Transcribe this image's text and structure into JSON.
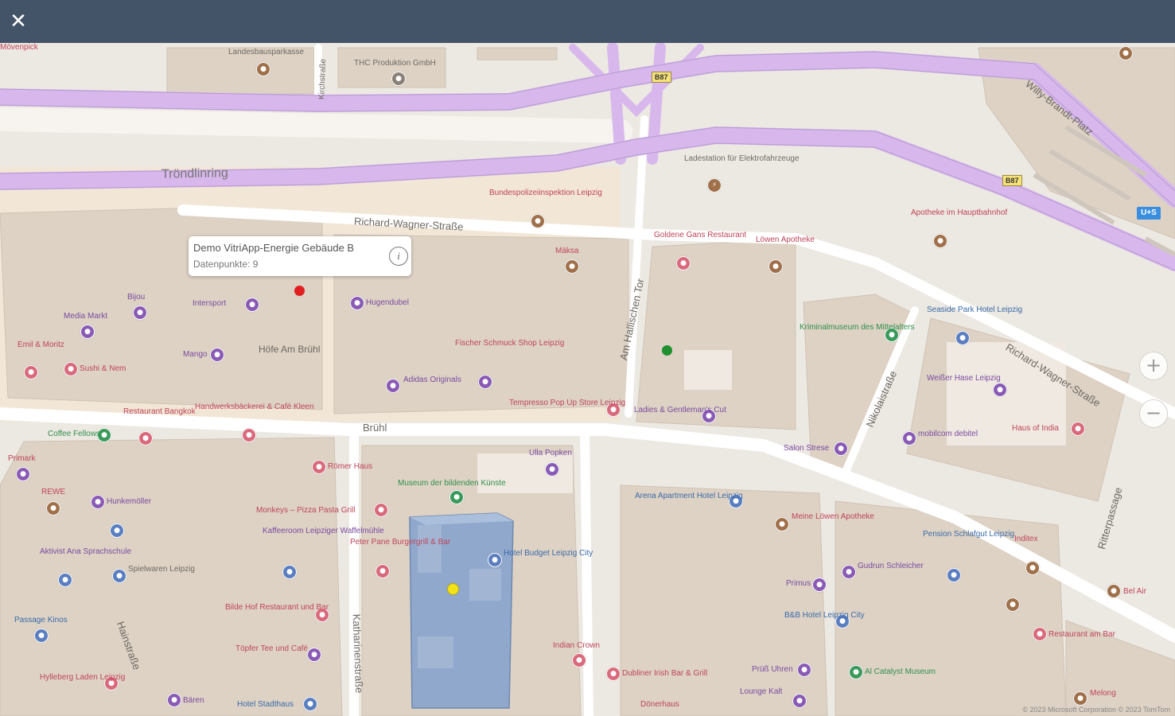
{
  "topbar": {
    "close_icon": "close-icon"
  },
  "tooltip": {
    "title": "Demo VitriApp-Energie Gebäude B",
    "subtitle": "Datenpunkte: 9",
    "info_icon": "info-icon"
  },
  "markers": [
    {
      "name": "red",
      "color": "#e02020"
    },
    {
      "name": "green",
      "color": "#1f8f2f"
    },
    {
      "name": "yellow",
      "color": "#f2e21a"
    }
  ],
  "streets": {
    "troendlinring": "Tröndlinring",
    "richard_wagner_1": "Richard-Wagner-Straße",
    "richard_wagner_2": "Richard-Wagner-Straße",
    "willy_brandt": "Willy-Brandt-Platz",
    "bruehl": "Brühl",
    "am_hallischen_tor": "Am Hallischen Tor",
    "nikolaistrasse": "Nikolaistraße",
    "hainstrasse": "Hainstraße",
    "katharinenstrasse": "Katharinenstraße",
    "ritterpassage": "Ritterpassage",
    "kirchstrasse": "Kirchstraße",
    "hoefe": "Höfe Am Brühl"
  },
  "shields": {
    "b87_a": "B87",
    "b87_b": "B87"
  },
  "transit_label": "U+S",
  "pois": {
    "p1": "Intersport",
    "p2": "Media Markt",
    "p3": "Bijou",
    "p4": "Mango",
    "p5": "Hugendubel",
    "p6": "Sushi & Nem",
    "p7": "Emil & Moritz",
    "p8": "Handwerksbäckerei & Café Kleen",
    "p9": "Restaurant Bangkok",
    "p10": "Coffee Fellows",
    "p11": "Primark",
    "p12": "REWE",
    "p13": "Hunkemöller",
    "p14": "Kaffeeroom Leipziger Waffelmühle",
    "p15": "Mövenpick",
    "p16": "Ulla Popken",
    "p17": "Museum der bildenden Künste",
    "p18": "Peter Pane Burgergrill & Bar",
    "p19": "Römer Haus",
    "p20": "Monkeys – Pizza Pasta Grill",
    "p21": "Bundespolizeiinspektion Leipzig",
    "p22": "Ladestation für Elektrofahrzeuge",
    "p23": "Goldene Gans Restaurant",
    "p24": "Löwen Apotheke",
    "p25": "Kriminalmuseum des Mittelalters",
    "p26": "Seaside Park Hotel Leipzig",
    "p27": "Apotheke im Hauptbahnhof",
    "p28": "Ladies & Gentleman's Cut",
    "p29": "Tempresso Pop Up Store Leipzig",
    "p30": "Adidas Originals",
    "p31": "Fischer Schmuck Shop Leipzig",
    "p32": "Weißer Hase Leipzig",
    "p33": "mobilcom debitel",
    "p34": "Haus of India",
    "p35": "Salon Strese",
    "p36": "Arena Apartment Hotel Leipzig",
    "p37": "Meine Löwen Apotheke",
    "p38": "Pension Schlafgut Leipzig",
    "p39": "Gudrun Schleicher",
    "p40": "Primus",
    "p41": "B&B Hotel Leipzig City",
    "p42": "Prüß Uhren",
    "p43": "Al Catalyst Museum",
    "p44": "Indian Crown",
    "p45": "Dubliner Irish Bar & Grill",
    "p46": "Dönerhaus",
    "p47": "Hotel Budget Leipzig City",
    "p48": "Passage Kinos",
    "p49": "Aktivist Ana Sprachschule",
    "p50": "Hylleberg Laden Leipzig",
    "p51": "Bären",
    "p52": "Hotel Stadthaus",
    "p53": "Bilde Hof Restaurant und Bar",
    "p54": "Töpfer Tee und Café",
    "p55": "Spielwaren Leipzig",
    "p56": "Mäksa",
    "p57": "Landesbausparkasse",
    "p58": "THC Produktion GmbH",
    "p59": "Inditex",
    "p60": "Bel Air",
    "p61": "Restaurant am Bar",
    "p62": "Melong",
    "p63": "Lounge Kalt"
  },
  "zoom": {
    "in": "+",
    "out": "−"
  },
  "copyright": "© 2023 Microsoft Corporation  © 2023 TomTom"
}
